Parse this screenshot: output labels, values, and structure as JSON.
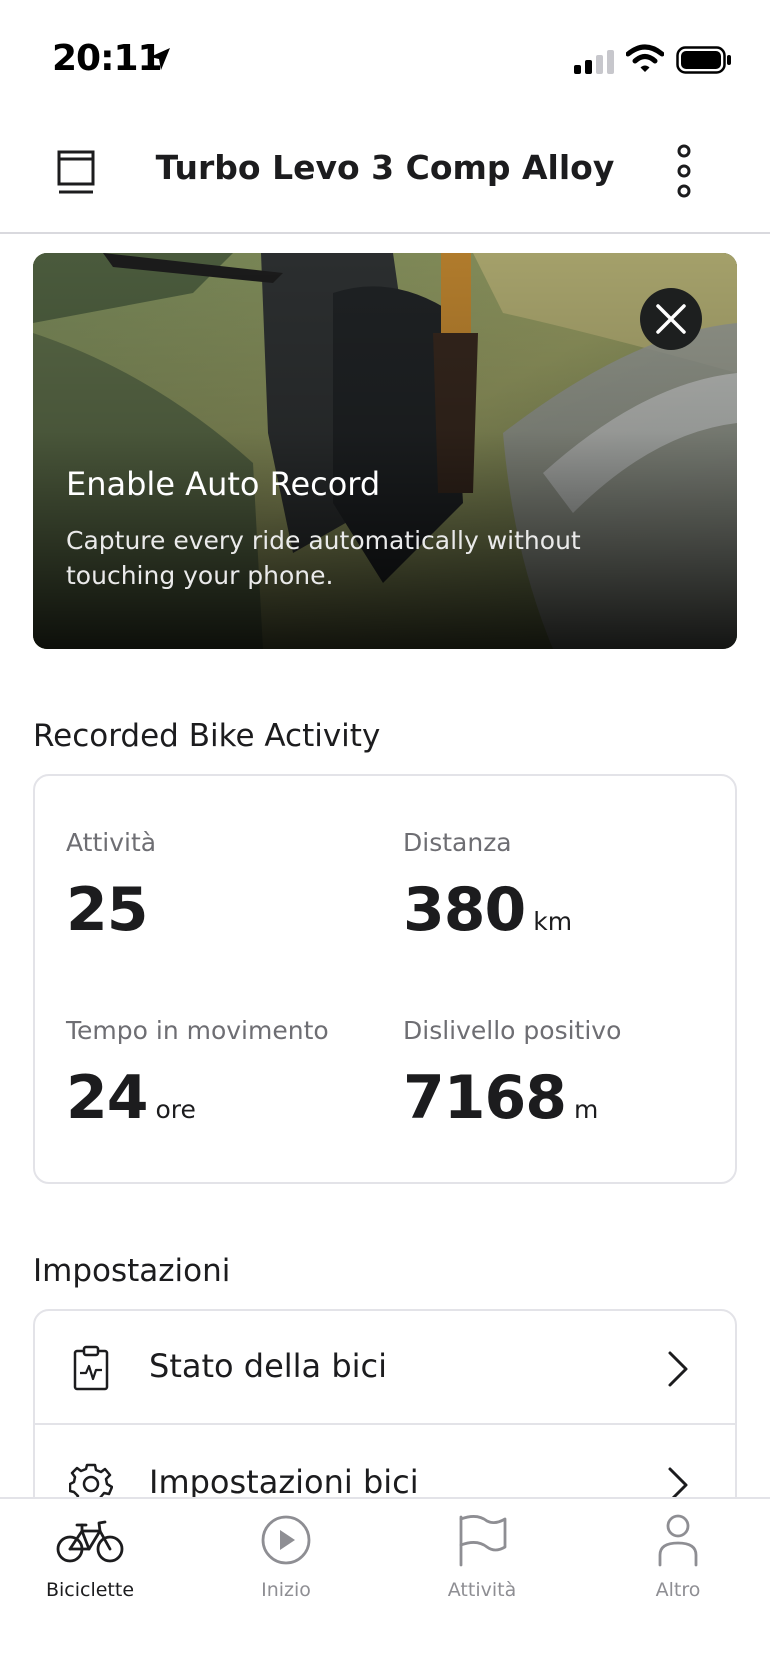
{
  "status_bar": {
    "time": "20:11"
  },
  "nav": {
    "title": "Turbo Levo 3 Comp Alloy"
  },
  "banner": {
    "title": "Enable Auto Record",
    "text": "Capture every ride automatically without touching your phone."
  },
  "activity": {
    "section_title": "Recorded Bike Activity",
    "stats": [
      {
        "label": "Attività",
        "value": "25",
        "unit": ""
      },
      {
        "label": "Distanza",
        "value": "380",
        "unit": "km"
      },
      {
        "label": "Tempo in movimento",
        "value": "24",
        "unit": "ore"
      },
      {
        "label": "Dislivello positivo",
        "value": "7168",
        "unit": "m"
      }
    ]
  },
  "settings": {
    "section_title": "Impostazioni",
    "items": [
      {
        "label": "Stato della bici",
        "icon": "clipboard-pulse-icon"
      },
      {
        "label": "Impostazioni bici",
        "icon": "gear-icon"
      }
    ]
  },
  "tabs": [
    {
      "label": "Biciclette",
      "icon": "bicycle-icon",
      "active": true
    },
    {
      "label": "Inizio",
      "icon": "play-icon",
      "active": false
    },
    {
      "label": "Attività",
      "icon": "flag-icon",
      "active": false
    },
    {
      "label": "Altro",
      "icon": "person-icon",
      "active": false
    }
  ],
  "colors": {
    "text": "#1c1c1e",
    "secondary_text": "#6e6e73",
    "inactive_tab": "#8e8e93",
    "divider": "#e3e3e8"
  }
}
